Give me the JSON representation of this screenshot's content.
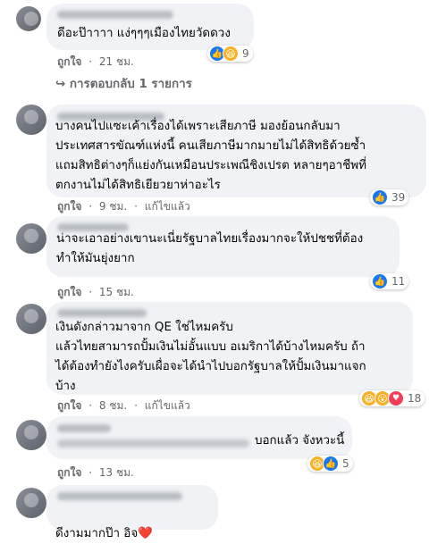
{
  "comments": [
    {
      "text": "ดีอะป๊าาาา แง่ๆๆๆเมืองไทยวัดดวง",
      "like_label": "ถูกใจ",
      "time": "21 ชม.",
      "edited": "",
      "reaction_count": "9",
      "replies_label": "การตอบกลับ 1 รายการ"
    },
    {
      "text": "บางคนไปแซะเค้าเรื่องได้เพราะเสียภาษี มองย้อนกลับมา\nประเทศสารขัณฑ์แห่งนี้ คนเสียภาษีมากมายไม่ได้สิทธิด้วยซ้ำ\nแถมสิทธิต่างๆก็แย่งกันเหมือนประเพณีชิงเปรต หลายๆอาชีพที่\nตกงานไม่ได้สิทธิเยียวยาห่าอะไร",
      "like_label": "ถูกใจ",
      "time": "9 ชม.",
      "edited": "แก้ไขแล้ว",
      "reaction_count": "39"
    },
    {
      "name": "ธนนฐา ลือจัง",
      "text": "น่าจะเอาอย่างเขานะเนี่ยรัฐบาลไทยเรื่องมากจะให้ปชชที่ต้อง\nทำให้มันยุ่งยาก",
      "like_label": "ถูกใจ",
      "time": "15 ชม.",
      "edited": "",
      "reaction_count": "11"
    },
    {
      "text": "เงินดังกล่าวมาจาก QE ใช่ไหมครับ\nแล้วไทยสามารถปั้มเงินไม่อั้นแบบ อเมริกาได้บ้างไหมครับ ถ้า\nได้ต้องทำยังไงครับเผื่อจะได้นำไปบอกรัฐบาลให้ปั้มเงินมาแจก\nบ้าง",
      "like_label": "ถูกใจ",
      "time": "8 ชม.",
      "edited": "แก้ไขแล้ว",
      "reaction_count": "18"
    },
    {
      "text": "บอกแล้ว จังหวะนี้",
      "like_label": "ถูกใจ",
      "time": "13 ชม.",
      "edited": "",
      "reaction_count": "5"
    },
    {
      "text": "ดีงามมากป๊า อิจ",
      "heart": "❤️"
    }
  ],
  "separator": "·",
  "reply_arrow": "↪",
  "colors": {
    "like": "#1877f2",
    "haha": "#f7b125",
    "love": "#f33e58",
    "meta": "#65676b",
    "bubble": "#f0f2f5"
  }
}
